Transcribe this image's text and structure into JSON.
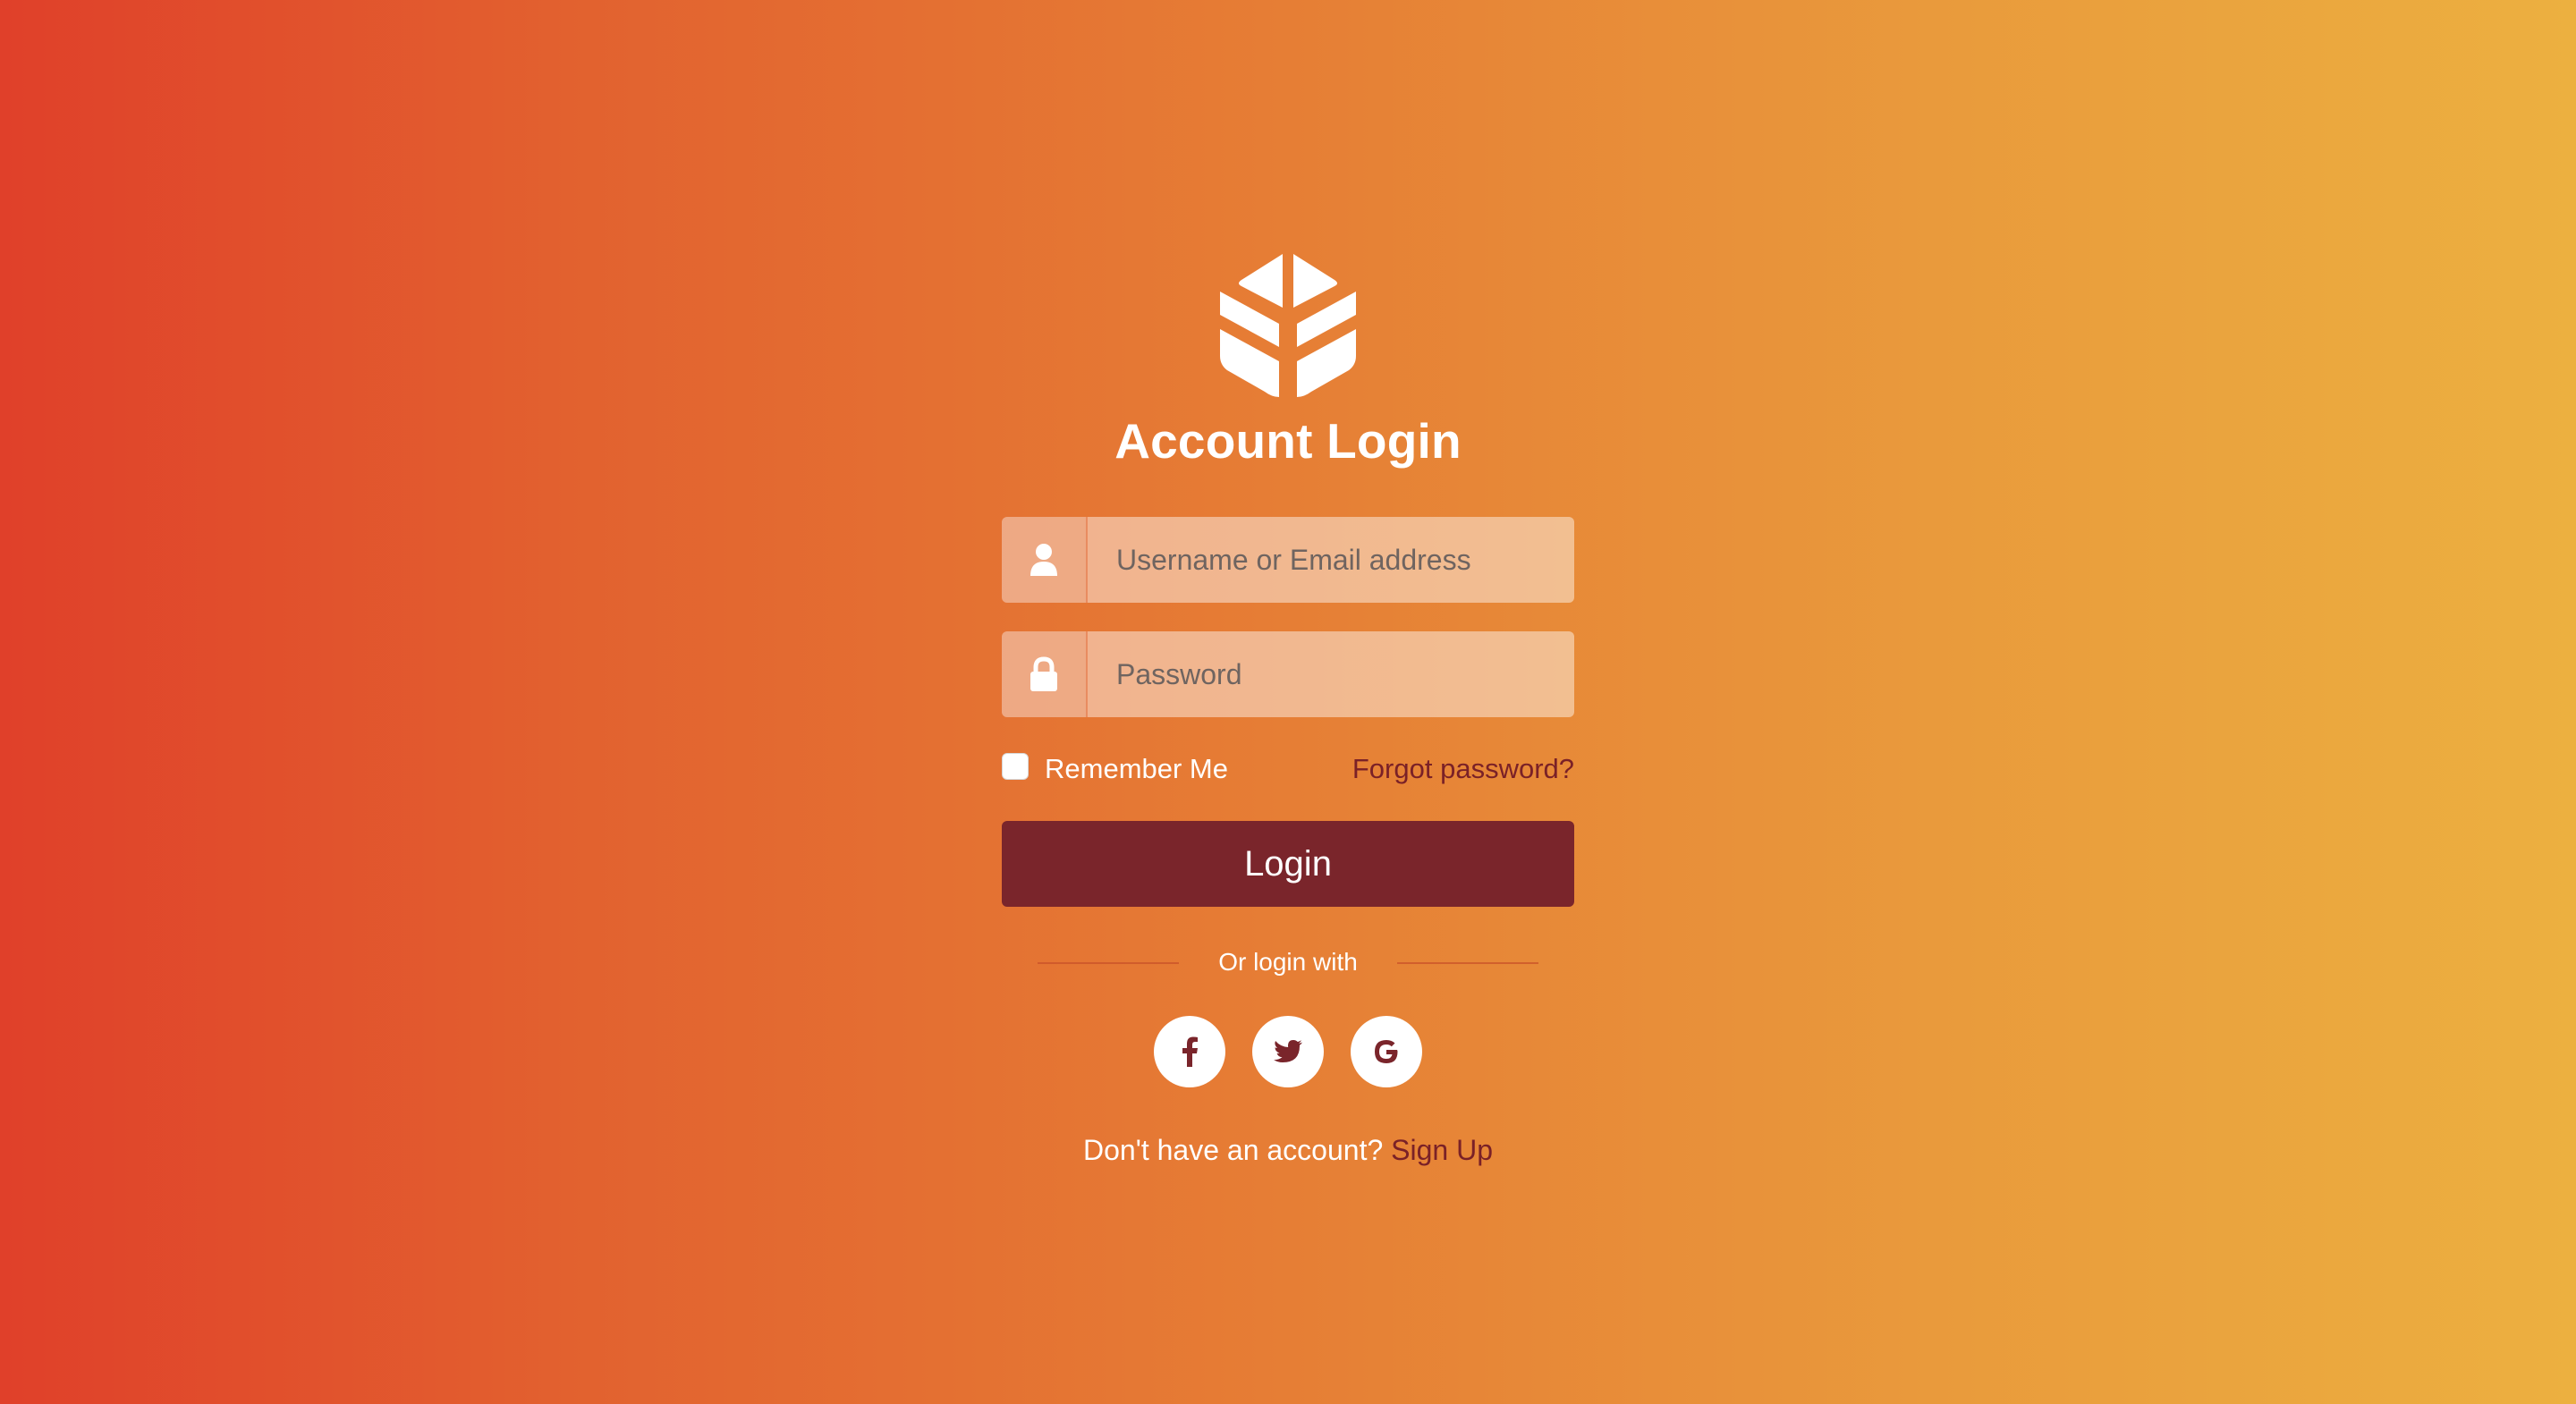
{
  "brand": {
    "logo_icon": "cube-logo-icon",
    "title": "Account Login"
  },
  "form": {
    "username": {
      "icon": "user-icon",
      "placeholder": "Username or Email address",
      "value": ""
    },
    "password": {
      "icon": "lock-icon",
      "placeholder": "Password",
      "value": ""
    },
    "remember_label": "Remember Me",
    "remember_checked": false,
    "forgot_label": "Forgot password?",
    "login_label": "Login"
  },
  "social": {
    "divider_text": "Or login with",
    "providers": [
      {
        "name": "facebook",
        "icon": "facebook-icon"
      },
      {
        "name": "twitter",
        "icon": "twitter-icon"
      },
      {
        "name": "google",
        "icon": "google-icon"
      }
    ]
  },
  "footer": {
    "prompt": "Don't have an account?",
    "signup_label": "Sign Up"
  },
  "colors": {
    "gradient_start": "#e0402a",
    "gradient_end": "#ecb040",
    "accent": "#7a252b",
    "link": "#7a2127"
  }
}
